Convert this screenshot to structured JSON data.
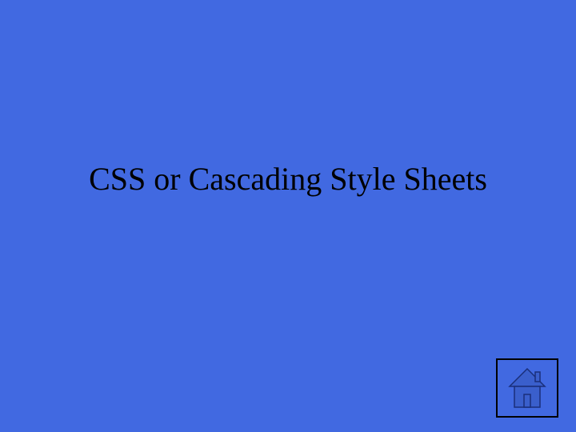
{
  "main": {
    "text": "CSS or Cascading Style Sheets"
  },
  "nav": {
    "home_label": "home"
  },
  "colors": {
    "background": "#4169E1",
    "house_fill": "#3A5FCC",
    "house_stroke": "#1A2F7A"
  }
}
